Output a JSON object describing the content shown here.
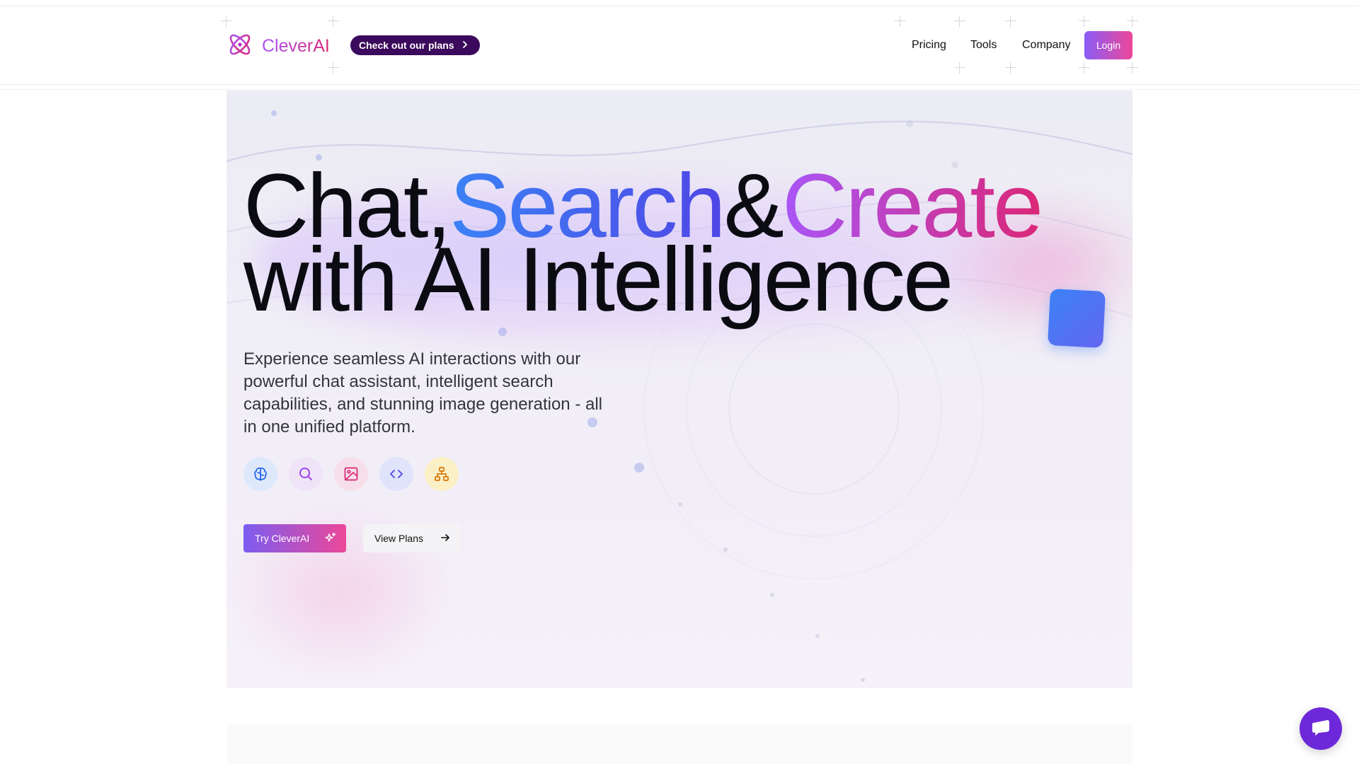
{
  "header": {
    "brand": "CleverAI",
    "promo_label": "Check out our plans",
    "nav": [
      "Pricing",
      "Tools",
      "Company"
    ],
    "login_label": "Login"
  },
  "hero": {
    "title_line1": {
      "part1": "Chat,",
      "part2": "Search",
      "part3": "&",
      "part4": "Create"
    },
    "title_line2": "with AI Intelligence",
    "subtitle": "Experience seamless AI interactions with our powerful chat assistant, intelligent search capabilities, and stunning image generation - all in one unified platform.",
    "feature_icons": [
      "brain-icon",
      "search-icon",
      "image-icon",
      "code-icon",
      "network-icon"
    ],
    "cta_primary": "Try CleverAI",
    "cta_secondary": "View Plans"
  },
  "colors": {
    "brand_gradient_start": "#a855f7",
    "brand_gradient_end": "#db2777",
    "promo_bg": "#3b0a5c",
    "chat_fab": "#6d28d9"
  }
}
